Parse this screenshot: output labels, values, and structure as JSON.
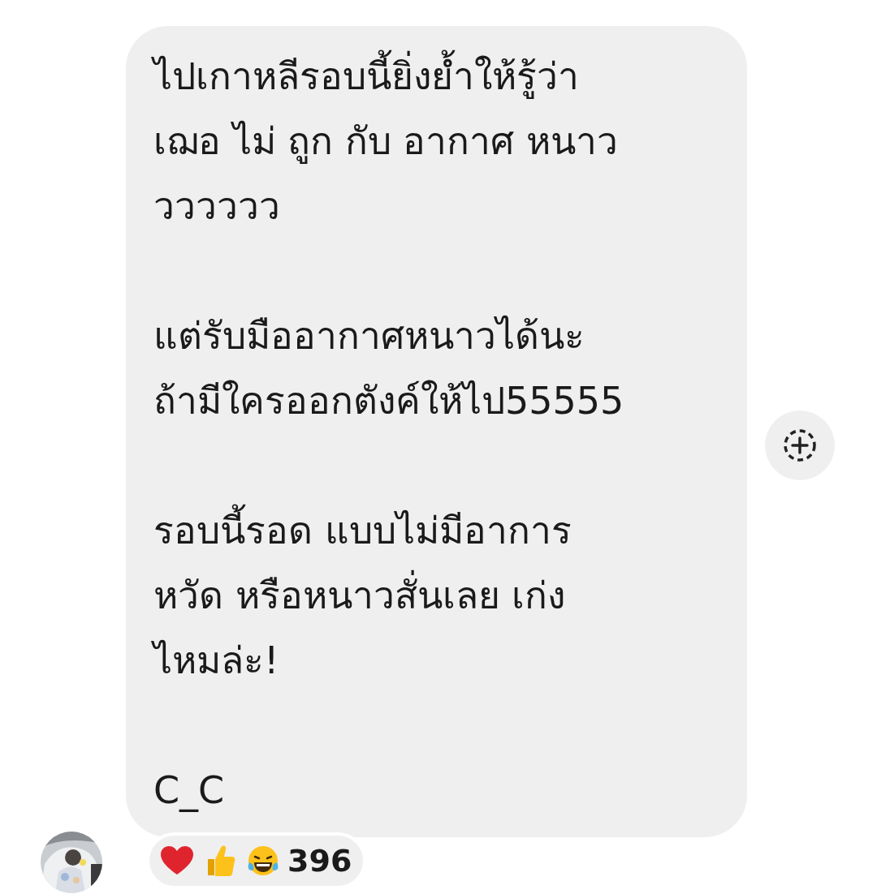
{
  "message": {
    "paragraphs": [
      [
        "ไปเกาหลีรอบนี้ยิ่งย้ำให้รู้ว่า",
        "เฌอ ไม่ ถูก กับ อากาศ หนาว",
        "วววววว"
      ],
      [
        "แต่รับมืออากาศหนาวได้นะ",
        "ถ้ามีใครออกตังค์ให้ไป55555"
      ],
      [
        "รอบนี้รอด แบบไม่มีอาการ",
        "หวัด หรือหนาวสั่นเลย เก่ง",
        "ไหมล่ะ!"
      ],
      [
        "C_C"
      ]
    ],
    "avatar": {
      "kind": "picture"
    },
    "reactions": {
      "emojis": [
        {
          "kind": "heart"
        },
        {
          "kind": "thumbs-up"
        },
        {
          "kind": "laughing"
        }
      ],
      "count": "396"
    }
  }
}
